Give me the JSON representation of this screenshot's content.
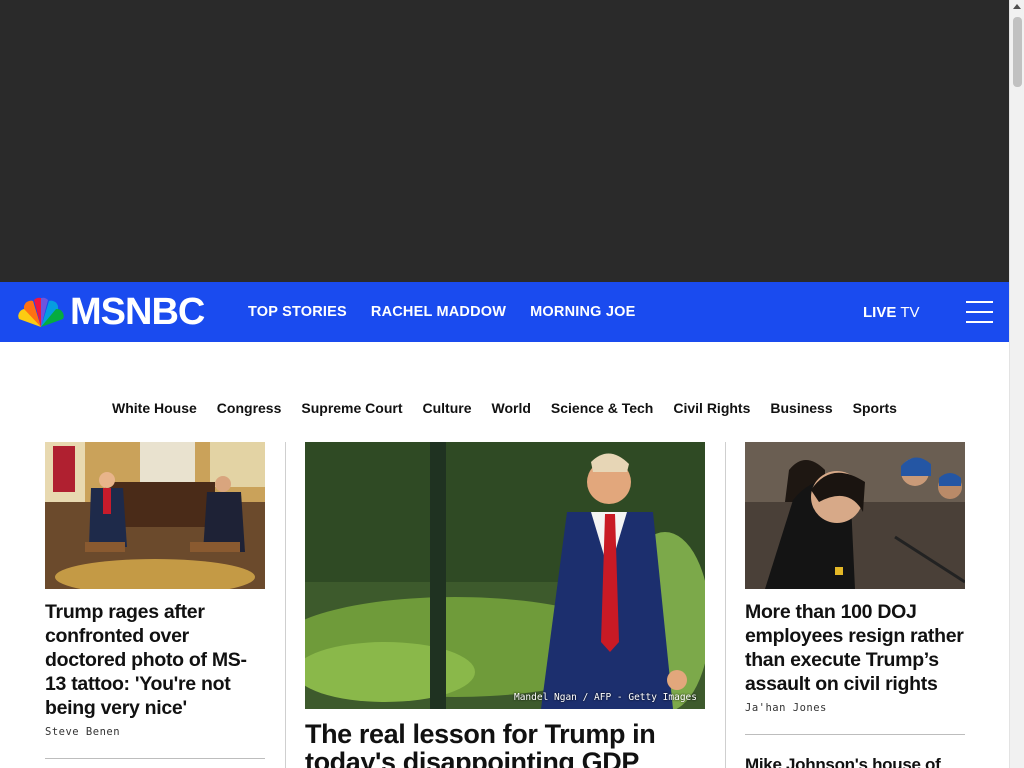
{
  "brand": {
    "name": "MSNBC",
    "peacock_colors": [
      "#fccc12",
      "#ef1541",
      "#6e55dc",
      "#069de0",
      "#05ac3f",
      "#ff7112"
    ]
  },
  "topnav": {
    "links": [
      "TOP STORIES",
      "RACHEL MADDOW",
      "MORNING JOE"
    ],
    "live_strong": "LIVE",
    "live_rest": "TV",
    "background": "#1a4bef"
  },
  "sections": [
    "White House",
    "Congress",
    "Supreme Court",
    "Culture",
    "World",
    "Science & Tech",
    "Civil Rights",
    "Business",
    "Sports"
  ],
  "left_story": {
    "headline": "Trump rages after confronted over doctored photo of MS-13 tattoo: 'You're not being very nice'",
    "byline": "Steve Benen"
  },
  "main_story": {
    "headline": "The real lesson for Trump in today's disappointing GDP report",
    "photo_credit": "Mandel Ngan / AFP - Getty Images"
  },
  "right_story": {
    "headline": "More than 100 DOJ employees resign rather than execute Trump’s assault on civil rights",
    "byline": "Ja'han Jones"
  },
  "right_story_2": {
    "headline": "Mike Johnson's house of"
  }
}
